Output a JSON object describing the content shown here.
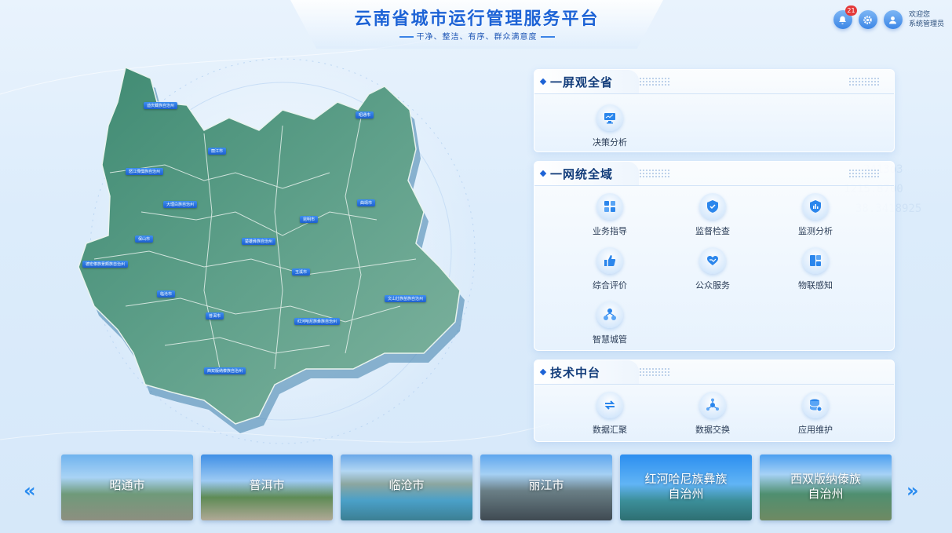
{
  "header": {
    "title": "云南省城市运行管理服务平台",
    "slogan": "干净、整洁、有序、群众满意度",
    "notification_count": "21",
    "welcome": "欢迎您",
    "username": "系统管理员"
  },
  "map": {
    "labels": [
      "迪庆藏族自治州",
      "昭通市",
      "丽江市",
      "怒江傈僳族自治州",
      "大理白族自治州",
      "曲靖市",
      "昆明市",
      "保山市",
      "楚雄彝族自治州",
      "德宏傣族景颇族自治州",
      "玉溪市",
      "临沧市",
      "普洱市",
      "红河哈尼族彝族自治州",
      "文山壮族苗族自治州",
      "西双版纳傣族自治州"
    ]
  },
  "panels": [
    {
      "title": "一屏观全省",
      "items": [
        {
          "label": "决策分析",
          "icon": "monitor-icon"
        }
      ]
    },
    {
      "title": "一网统全域",
      "items": [
        {
          "label": "业务指导",
          "icon": "grid-icon"
        },
        {
          "label": "监督检查",
          "icon": "shield-icon"
        },
        {
          "label": "监测分析",
          "icon": "shield-chart-icon"
        },
        {
          "label": "综合评价",
          "icon": "thumbs-up-icon"
        },
        {
          "label": "公众服务",
          "icon": "heart-hand-icon"
        },
        {
          "label": "物联感知",
          "icon": "iot-icon"
        },
        {
          "label": "智慧城管",
          "icon": "network-icon"
        }
      ]
    },
    {
      "title": "技术中台",
      "items": [
        {
          "label": "数据汇聚",
          "icon": "sync-icon"
        },
        {
          "label": "数据交换",
          "icon": "exchange-icon"
        },
        {
          "label": "应用维护",
          "icon": "database-icon"
        }
      ]
    }
  ],
  "carousel": {
    "prev": "«",
    "next": "»",
    "cities": [
      {
        "name": "昭通市"
      },
      {
        "name": "普洱市"
      },
      {
        "name": "临沧市"
      },
      {
        "name": "丽江市"
      },
      {
        "name": "红河哈尼族彝族\n自治州"
      },
      {
        "name": "西双版纳傣族\n自治州"
      }
    ]
  }
}
